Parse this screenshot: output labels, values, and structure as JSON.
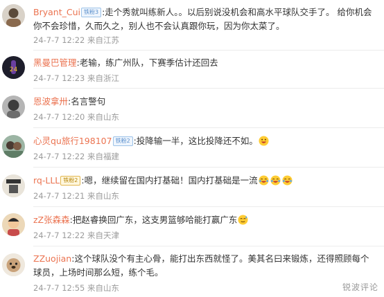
{
  "comments": [
    {
      "username": "Bryant_Cui",
      "badge": "铁粉3",
      "badge_color": "#5a8fcc",
      "text": ":走个秀就叫练新人。。以后别说没机会和高水平球队交手了。 给你机会你不会珍惜，久而久之，别人也不会认真跟你玩，因为你太菜了。",
      "time": "24-7-7 12:22",
      "location": "来自江苏",
      "emojis": []
    },
    {
      "username": "黑曼巴管理",
      "badge": "",
      "text": ":老输，练广州队，下赛季估计还回去",
      "time": "24-7-7 12:23",
      "location": "来自浙江",
      "emojis": []
    },
    {
      "username": "恩波拿卅",
      "badge": "",
      "text": ":名言警句",
      "time": "24-7-7 12:20",
      "location": "来自山东",
      "emojis": []
    },
    {
      "username": "心灵qu旅行198107",
      "badge": "铁粉2",
      "badge_color": "#5a8fcc",
      "text": ":投降输一半，这比投降还不如。",
      "time": "24-7-7 12:22",
      "location": "来自福建",
      "emojis": [
        "grin-emoji"
      ]
    },
    {
      "username": "rq-LLL",
      "badge": "铁粉2",
      "badge_color": "#b7860b",
      "text": ":嗯，继续留在国内打基础！国内打基础是一流",
      "time": "24-7-7 12:21",
      "location": "来自山东",
      "emojis": [
        "laugh-cry-emoji",
        "laugh-cry-emoji",
        "laugh-cry-emoji"
      ]
    },
    {
      "username": "zZ张森森",
      "badge": "",
      "text": ":把赵睿换回广东，这支男篮够哈能打赢广东",
      "time": "24-7-7 12:22",
      "location": "来自天津",
      "emojis": [
        "sweat-emoji"
      ]
    },
    {
      "username": "ZZuojian",
      "badge": "",
      "text": ":这个球队没个有主心骨，能打出东西就怪了。美其名曰来锻炼，还得照顾每个球员，上场时间那么短，练个毛。",
      "time": "24-7-7 12:55",
      "location": "来自山东",
      "emojis": []
    }
  ],
  "watermark": "锐波评论"
}
